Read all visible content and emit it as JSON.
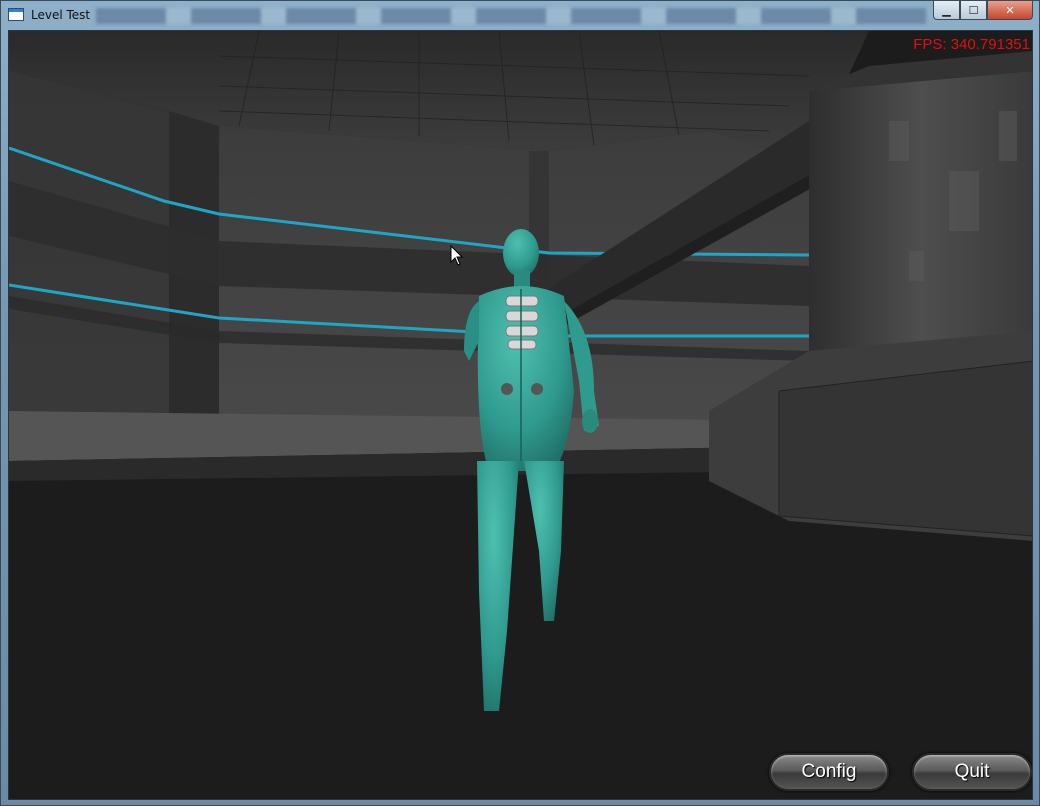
{
  "window": {
    "title": "Level Test",
    "controls": {
      "minimize": "▁",
      "maximize": "☐",
      "close": "✕"
    }
  },
  "hud": {
    "fps": "FPS: 340.791351",
    "config_label": "Config",
    "quit_label": "Quit"
  },
  "colors": {
    "accent_line": "#1fa6c7",
    "character": "#2f9a8e",
    "fps": "#e01010"
  },
  "icons": [
    "app-window-icon",
    "mouse-cursor-icon",
    "minimize-icon",
    "maximize-icon",
    "close-icon"
  ]
}
